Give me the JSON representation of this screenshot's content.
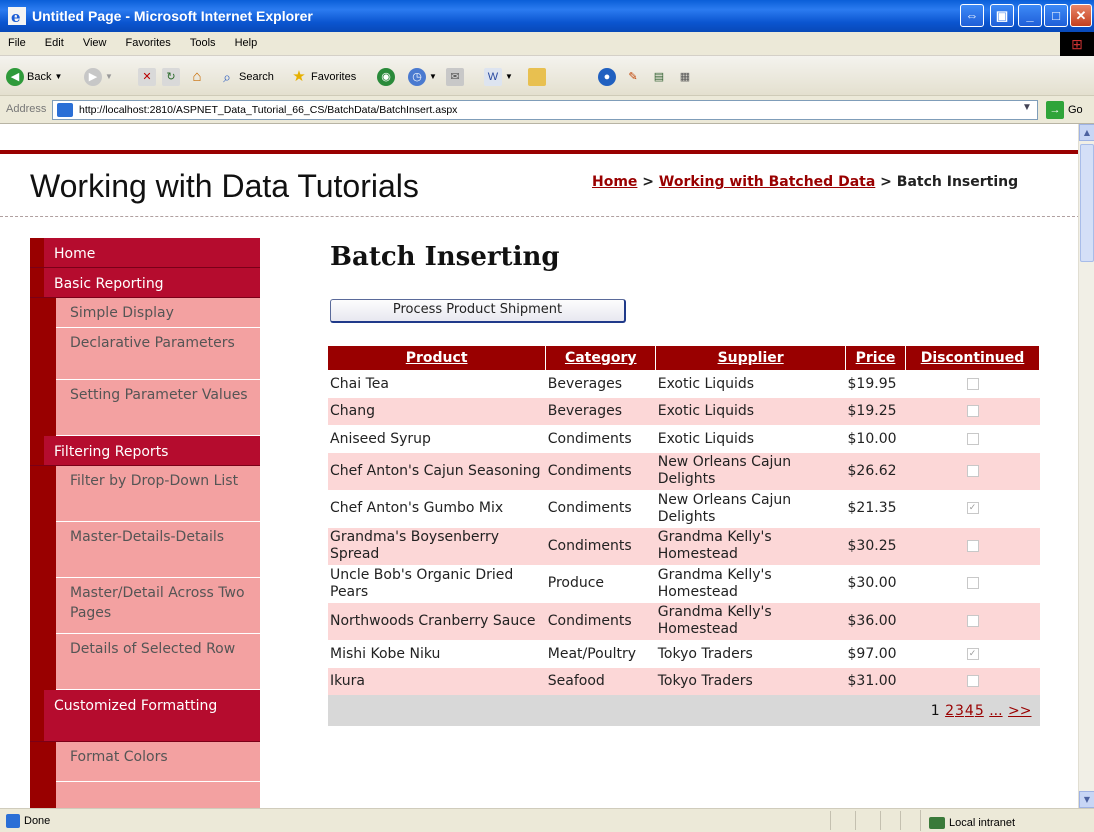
{
  "window": {
    "title": "Untitled Page - Microsoft Internet Explorer",
    "buttons": [
      "restore-down",
      "restore",
      "minimize",
      "maximize",
      "close"
    ]
  },
  "menubar": [
    "File",
    "Edit",
    "View",
    "Favorites",
    "Tools",
    "Help"
  ],
  "toolbar": {
    "back": "Back",
    "search": "Search",
    "favorites": "Favorites"
  },
  "address": {
    "label": "Address",
    "url": "http://localhost:2810/ASPNET_Data_Tutorial_66_CS/BatchData/BatchInsert.aspx",
    "go": "Go"
  },
  "site": {
    "title": "Working with Data Tutorials",
    "breadcrumb": {
      "home": "Home",
      "sep1": " > ",
      "section": "Working with Batched Data",
      "sep2": " > ",
      "current": "Batch Inserting"
    }
  },
  "sidebar": [
    {
      "type": "head",
      "label": "Home"
    },
    {
      "type": "head",
      "label": "Basic Reporting"
    },
    {
      "type": "sub",
      "label": "Simple Display"
    },
    {
      "type": "sub",
      "label": "Declarative Parameters"
    },
    {
      "type": "sub",
      "label": "Setting Parameter Values"
    },
    {
      "type": "head",
      "label": "Filtering Reports"
    },
    {
      "type": "sub",
      "label": "Filter by Drop-Down List"
    },
    {
      "type": "sub",
      "label": "Master-Details-Details"
    },
    {
      "type": "sub",
      "label": "Master/Detail Across Two Pages"
    },
    {
      "type": "sub",
      "label": "Details of Selected Row"
    },
    {
      "type": "head",
      "label": "Customized Formatting"
    },
    {
      "type": "sub",
      "label": "Format Colors"
    }
  ],
  "main": {
    "heading": "Batch Inserting",
    "process_button": "Process Product Shipment"
  },
  "grid": {
    "columns": [
      "Product",
      "Category",
      "Supplier",
      "Price",
      "Discontinued"
    ],
    "rows": [
      {
        "product": "Chai Tea",
        "category": "Beverages",
        "supplier": "Exotic Liquids",
        "price": "$19.95",
        "discontinued": false
      },
      {
        "product": "Chang",
        "category": "Beverages",
        "supplier": "Exotic Liquids",
        "price": "$19.25",
        "discontinued": false
      },
      {
        "product": "Aniseed Syrup",
        "category": "Condiments",
        "supplier": "Exotic Liquids",
        "price": "$10.00",
        "discontinued": false
      },
      {
        "product": "Chef Anton's Cajun Seasoning",
        "category": "Condiments",
        "supplier": "New Orleans Cajun Delights",
        "price": "$26.62",
        "discontinued": false
      },
      {
        "product": "Chef Anton's Gumbo Mix",
        "category": "Condiments",
        "supplier": "New Orleans Cajun Delights",
        "price": "$21.35",
        "discontinued": true
      },
      {
        "product": "Grandma's Boysenberry Spread",
        "category": "Condiments",
        "supplier": "Grandma Kelly's Homestead",
        "price": "$30.25",
        "discontinued": false
      },
      {
        "product": "Uncle Bob's Organic Dried Pears",
        "category": "Produce",
        "supplier": "Grandma Kelly's Homestead",
        "price": "$30.00",
        "discontinued": false
      },
      {
        "product": "Northwoods Cranberry Sauce",
        "category": "Condiments",
        "supplier": "Grandma Kelly's Homestead",
        "price": "$36.00",
        "discontinued": false
      },
      {
        "product": "Mishi Kobe Niku",
        "category": "Meat/Poultry",
        "supplier": "Tokyo Traders",
        "price": "$97.00",
        "discontinued": true
      },
      {
        "product": "Ikura",
        "category": "Seafood",
        "supplier": "Tokyo Traders",
        "price": "$31.00",
        "discontinued": false
      }
    ],
    "pager": {
      "current": "1",
      "pages": [
        "2",
        "3",
        "4",
        "5",
        "..."
      ],
      "next": ">>"
    }
  },
  "status": {
    "left": "Done",
    "zone": "Local intranet"
  },
  "colors": {
    "accent": "#990000",
    "nav_head": "#b50c2e",
    "nav_sub": "#f3a1a1",
    "row_alt": "#fcd7d7"
  }
}
